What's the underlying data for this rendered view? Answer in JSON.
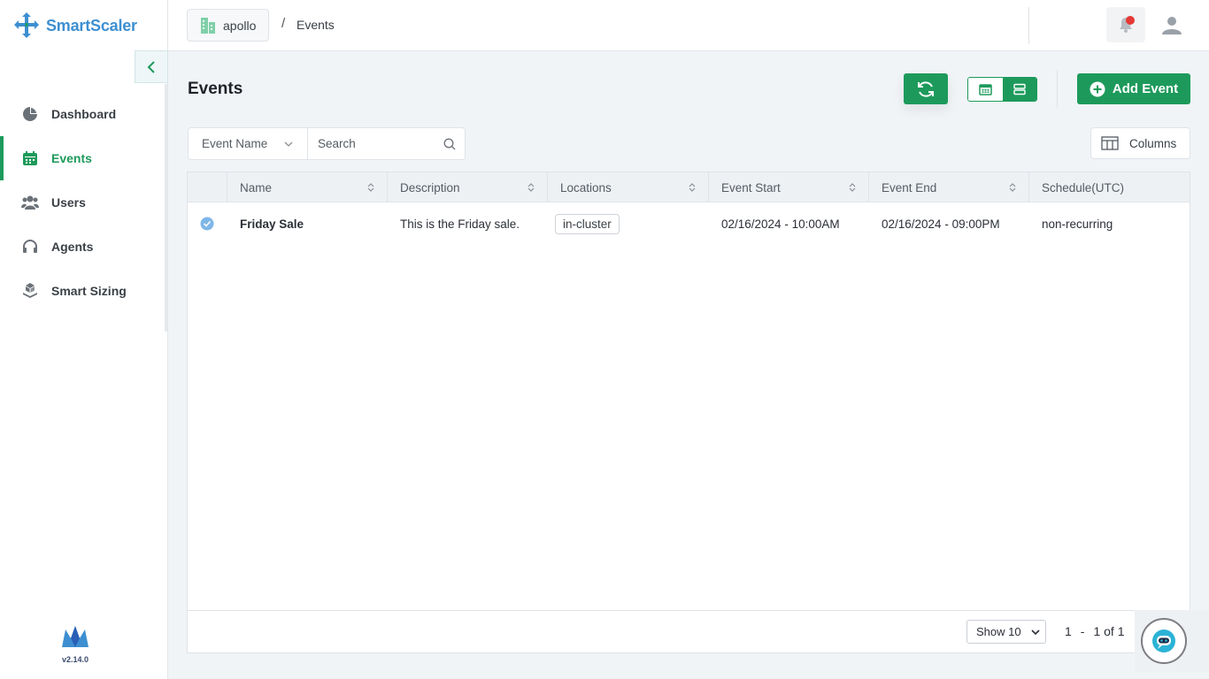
{
  "app": {
    "name": "SmartScaler",
    "version": "v2.14.0"
  },
  "colors": {
    "accent": "#1d9a5b",
    "brand": "#3d8fd1",
    "alert": "#e53935"
  },
  "sidebar": {
    "items": [
      {
        "label": "Dashboard",
        "icon": "pie-chart-icon",
        "active": false
      },
      {
        "label": "Events",
        "icon": "calendar-icon",
        "active": true
      },
      {
        "label": "Users",
        "icon": "users-icon",
        "active": false
      },
      {
        "label": "Agents",
        "icon": "headset-icon",
        "active": false
      },
      {
        "label": "Smart Sizing",
        "icon": "cube-stack-icon",
        "active": false
      }
    ]
  },
  "header": {
    "tenant": "apollo",
    "separator": "/",
    "page": "Events"
  },
  "main": {
    "title": "Events",
    "add_button": "Add Event",
    "filter": {
      "field": "Event Name",
      "search_placeholder": "Search"
    },
    "columns_button": "Columns",
    "table": {
      "columns": [
        "Name",
        "Description",
        "Locations",
        "Event Start",
        "Event End",
        "Schedule(UTC)"
      ],
      "rows": [
        {
          "selected": true,
          "name": "Friday Sale",
          "description": "This is the Friday sale.",
          "location": "in-cluster",
          "start": "02/16/2024 - 10:00AM",
          "end": "02/16/2024 - 09:00PM",
          "schedule": "non-recurring"
        }
      ]
    },
    "pagination": {
      "page_size": "Show 10",
      "range_start": "1",
      "dash": "-",
      "range_text": "1 of 1"
    }
  }
}
